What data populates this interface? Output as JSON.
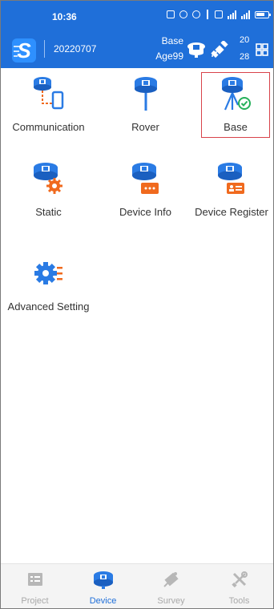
{
  "status_bar": {
    "time": "10:36"
  },
  "header": {
    "project_name": "20220707",
    "mode": "Base",
    "age": "Age99",
    "sat_used": "20",
    "sat_visible": "28"
  },
  "tiles": [
    {
      "label": "Communication",
      "icon": "communication-icon"
    },
    {
      "label": "Rover",
      "icon": "rover-receiver-icon"
    },
    {
      "label": "Base",
      "icon": "base-station-icon",
      "selected": true
    },
    {
      "label": "Static",
      "icon": "static-icon"
    },
    {
      "label": "Device Info",
      "icon": "device-info-icon"
    },
    {
      "label": "Device Register",
      "icon": "device-register-icon"
    },
    {
      "label": "Advanced Setting",
      "icon": "advanced-setting-icon"
    }
  ],
  "bottom_nav": [
    {
      "label": "Project",
      "icon": "project-icon",
      "active": false
    },
    {
      "label": "Device",
      "icon": "device-icon",
      "active": true
    },
    {
      "label": "Survey",
      "icon": "survey-icon",
      "active": false
    },
    {
      "label": "Tools",
      "icon": "tools-icon",
      "active": false
    }
  ],
  "colors": {
    "header_blue": "#1f6fd9",
    "icon_blue": "#2a7be4",
    "icon_orange": "#f06a1e",
    "selection_red": "#d8434a",
    "check_green": "#25b05a"
  }
}
